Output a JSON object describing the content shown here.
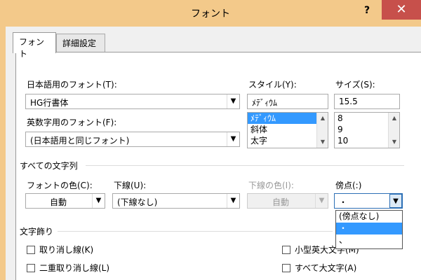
{
  "window": {
    "title": "フォント",
    "help_label": "?",
    "close_label": "✕"
  },
  "tabs": [
    {
      "label": "フォント",
      "active": true
    },
    {
      "label": "詳細設定",
      "active": false
    }
  ],
  "font": {
    "japanese_label": "日本語用のフォント(T):",
    "japanese_value": "HG行書体",
    "latin_label": "英数字用のフォント(F):",
    "latin_value": "(日本語用と同じフォント)"
  },
  "style": {
    "label": "スタイル(Y):",
    "value": "ﾒﾃﾞｨｳﾑ",
    "options": [
      "ﾒﾃﾞｨｳﾑ",
      "斜体",
      "太字"
    ],
    "selected_index": 0
  },
  "size": {
    "label": "サイズ(S):",
    "value": "15.5",
    "options": [
      "8",
      "9",
      "10"
    ]
  },
  "all_text": {
    "section_label": "すべての文字列",
    "font_color_label": "フォントの色(C):",
    "font_color_value": "自動",
    "underline_label": "下線(U):",
    "underline_value": "(下線なし)",
    "underline_color_label": "下線の色(I):",
    "underline_color_value": "自動",
    "emphasis_label": "傍点(:)",
    "emphasis_value": "・",
    "emphasis_options": [
      "(傍点なし)",
      "・",
      "、"
    ],
    "emphasis_selected_index": 1
  },
  "effects": {
    "section_label": "文字飾り",
    "strikethrough": "取り消し線(K)",
    "double_strikethrough": "二重取り消し線(L)",
    "small_caps": "小型英大文字(M)",
    "all_caps": "すべて大文字(A)"
  },
  "colors": {
    "title_bg": "#f3c98a",
    "close_bg": "#c7504b",
    "selection": "#3399ff"
  }
}
